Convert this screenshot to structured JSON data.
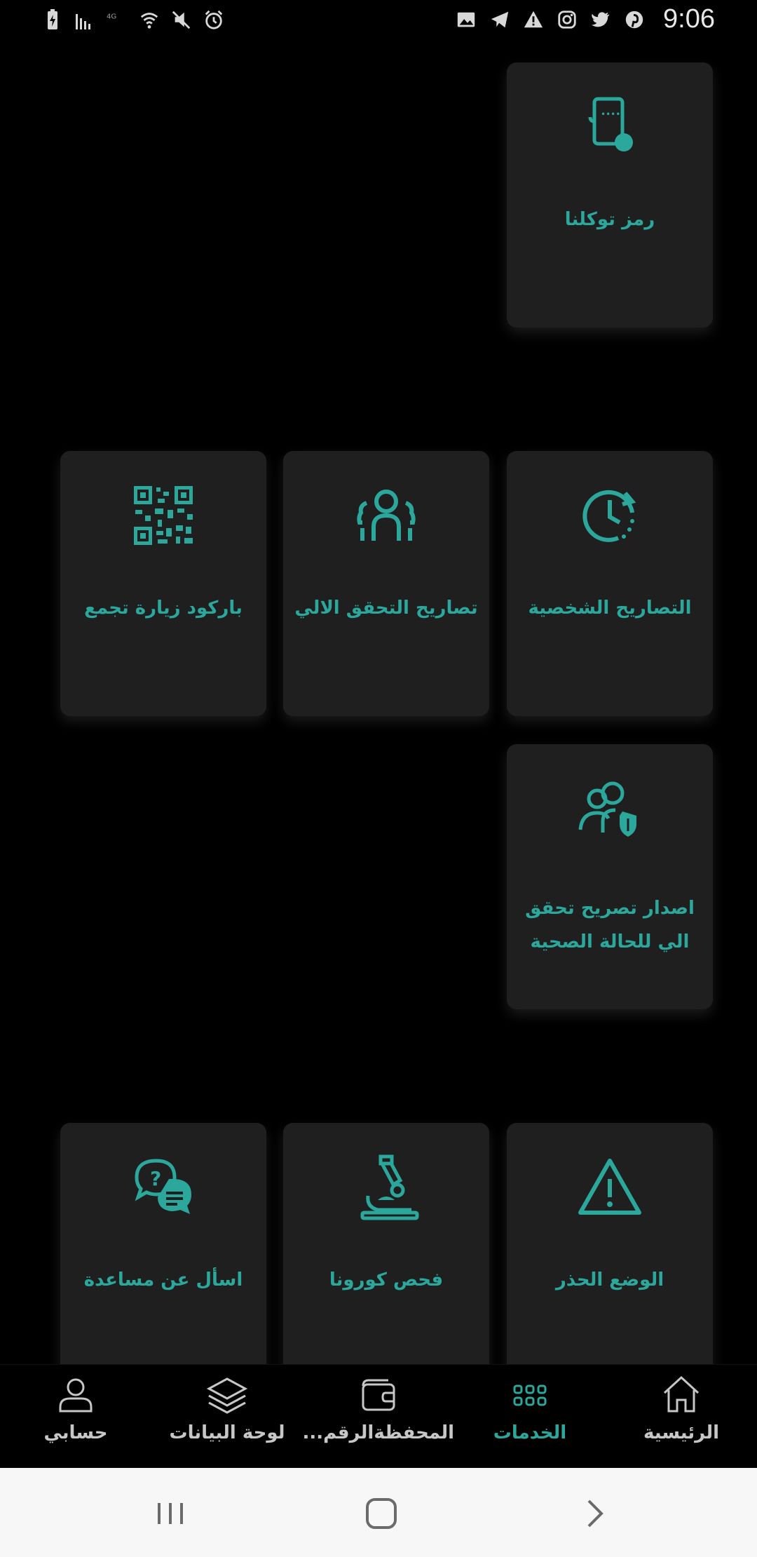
{
  "status_bar": {
    "time": "9:06",
    "left_icons": [
      "battery-charging-icon",
      "signal-icon",
      "lte-icon",
      "wifi-icon",
      "mute-icon",
      "alarm-icon"
    ],
    "right_icons": [
      "image-icon",
      "telegram-icon",
      "warning-icon",
      "instagram-icon",
      "twitter-icon",
      "pinterest-icon"
    ]
  },
  "services": {
    "tawakkalna_code": "رمز توكلنا",
    "visit_barcode": "باركود زيارة تجمع",
    "auto_verify_permits": "تصاريح التحقق الالي",
    "personal_permits": "التصاريح الشخصية",
    "issue_health_permit_line1": "اصدار تصريح تحقق",
    "issue_health_permit_line2": "الي للحالة الصحية",
    "ask_help": "اسأل عن مساعدة",
    "corona_test": "فحص كورونا",
    "caution_mode": "الوضع الحذر"
  },
  "bottom_nav": {
    "account": "حسابي",
    "dashboard": "لوحة البيانات",
    "wallet": "المحفظةالرقم...",
    "services": "الخدمات",
    "home": "الرئيسية",
    "active": "services"
  },
  "colors": {
    "accent": "#2ba79c",
    "card_bg": "#1f1f1f",
    "background": "#000000"
  }
}
